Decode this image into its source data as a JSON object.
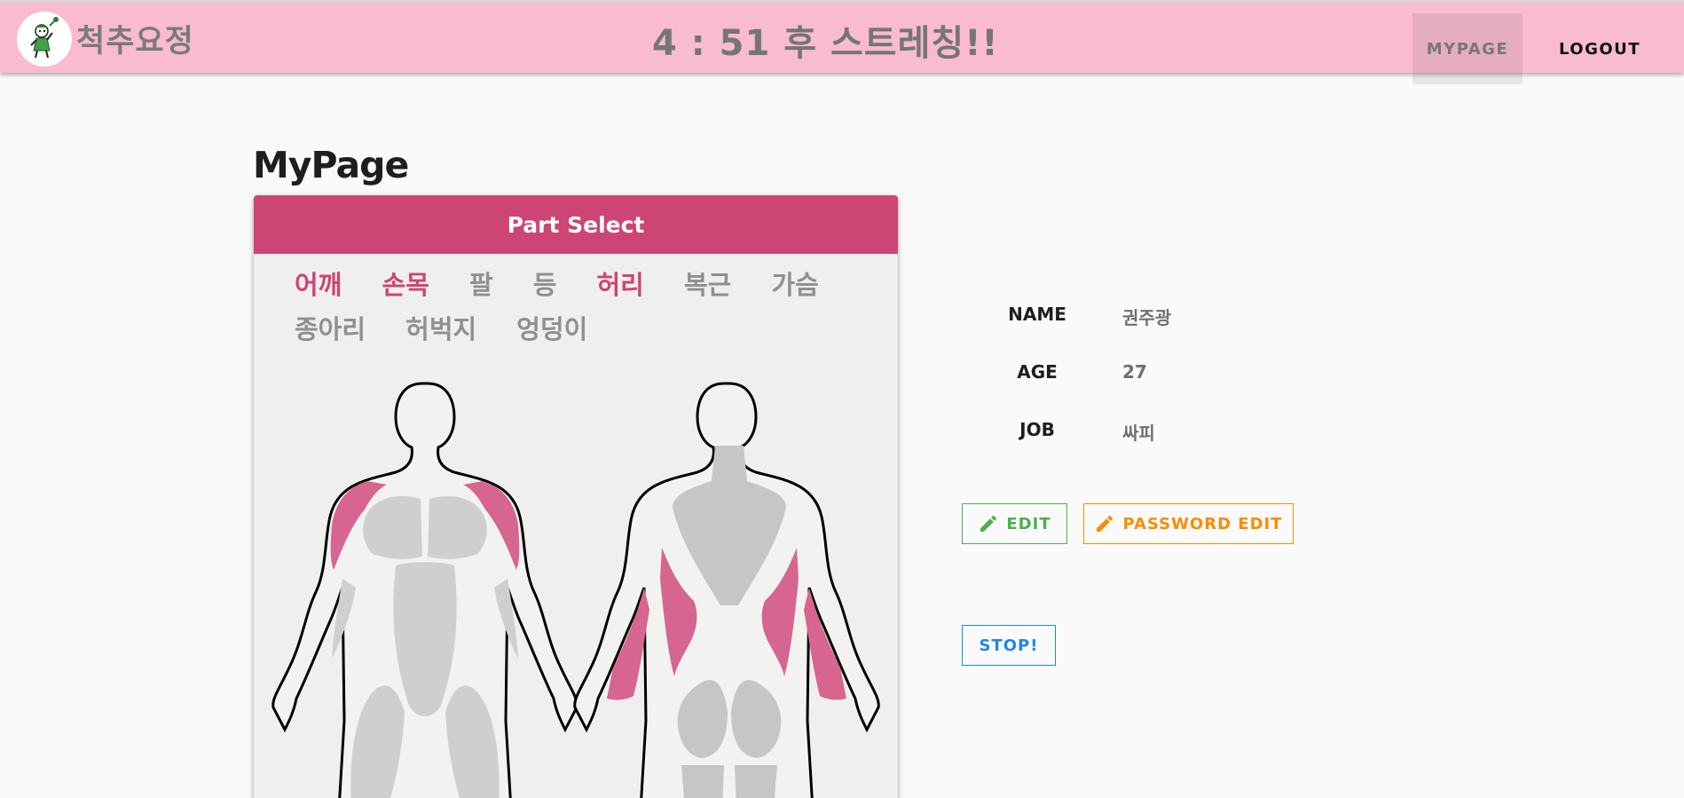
{
  "header": {
    "brand": "척추요정",
    "timer": "4 : 51 후 스트레칭!!",
    "nav": {
      "mypage": "MYPAGE",
      "logout": "LOGOUT"
    },
    "color": "#f8bbd0"
  },
  "page_title": "MyPage",
  "part_select": {
    "title": "Part Select",
    "accent": "#cc4574",
    "parts": [
      {
        "label": "어깨",
        "selected": true
      },
      {
        "label": "손목",
        "selected": true
      },
      {
        "label": "팔",
        "selected": false
      },
      {
        "label": "등",
        "selected": false
      },
      {
        "label": "허리",
        "selected": true
      },
      {
        "label": "복근",
        "selected": false
      },
      {
        "label": "가슴",
        "selected": false
      },
      {
        "label": "종아리",
        "selected": false
      },
      {
        "label": "허벅지",
        "selected": false
      },
      {
        "label": "엉덩이",
        "selected": false
      }
    ]
  },
  "profile": {
    "name_label": "NAME",
    "name": "권주광",
    "age_label": "AGE",
    "age": "27",
    "job_label": "JOB",
    "job": "싸피"
  },
  "buttons": {
    "edit": "EDIT",
    "password_edit": "PASSWORD EDIT",
    "stop": "STOP!"
  },
  "colors": {
    "edit": "#4caf50",
    "password_edit": "#fb8c00",
    "stop": "#1e88e5"
  }
}
